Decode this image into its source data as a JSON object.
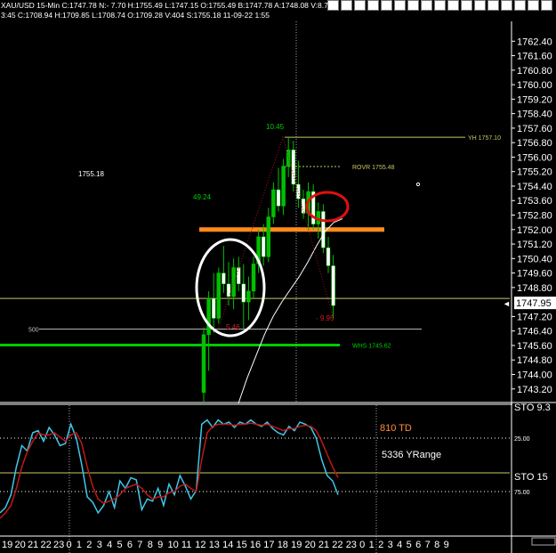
{
  "header": {
    "line1": "XAU/USD 15-Min C:1747.78 N:- 7.70 H:1755.49 L:1747.15 O:1755.49 B:1747.78 A:1748.08 V:8.77",
    "line2": "3:45 C:1708.94 H:1709.85 L:1708.74 O:1709.28 V:404 S:1755.18 11-09-22 1:55"
  },
  "toolbar": {
    "icons": [
      "help-icon",
      "candles-icon",
      "crosshair-icon",
      "draw-line-icon",
      "fib-icon",
      "line-icon",
      "zoom-icon",
      "stop-icon",
      "clock-icon",
      "refresh-icon",
      "layout-icon",
      "arrow-icon",
      "cross-icon",
      "text-icon",
      "move-icon",
      "split-icon",
      "window-icon"
    ]
  },
  "colors": {
    "background": "#000000",
    "candle_up": "#00c000",
    "candle_down": "#ffffff",
    "ma_line": "#ffffff",
    "level_line": "#c8c864",
    "orange_line": "#ff8c1a",
    "green_line": "#00cc00",
    "grey_line": "#c0c0c0",
    "red_circle": "#e01010",
    "stoch_fast": "#40c8e8",
    "stoch_slow": "#c01818",
    "annotation_orange": "#ff8c3a"
  },
  "chart_data": [
    {
      "type": "candlestick",
      "title": "XAU/USD 15-Min",
      "ylim": [
        1742.5,
        1763.2
      ],
      "y_ticks": [
        "1762.40",
        "1761.60",
        "1760.80",
        "1760.00",
        "1759.20",
        "1758.40",
        "1757.60",
        "1756.80",
        "1756.00",
        "1755.20",
        "1754.40",
        "1753.60",
        "1752.80",
        "1752.00",
        "1751.20",
        "1750.40",
        "1749.60",
        "1748.80",
        "1747.20",
        "1746.40",
        "1745.60",
        "1744.80",
        "1744.00",
        "1743.20"
      ],
      "last_price": "1747.95",
      "candles": [
        {
          "o": 1743.0,
          "h": 1746.6,
          "l": 1742.5,
          "c": 1746.2
        },
        {
          "o": 1746.2,
          "h": 1748.6,
          "l": 1744.2,
          "c": 1748.2
        },
        {
          "o": 1748.2,
          "h": 1749.6,
          "l": 1746.3,
          "c": 1747.1
        },
        {
          "o": 1747.1,
          "h": 1749.9,
          "l": 1746.8,
          "c": 1749.6
        },
        {
          "o": 1749.6,
          "h": 1751.1,
          "l": 1748.5,
          "c": 1749.0
        },
        {
          "o": 1749.0,
          "h": 1750.2,
          "l": 1747.8,
          "c": 1748.3
        },
        {
          "o": 1748.3,
          "h": 1750.4,
          "l": 1747.6,
          "c": 1749.9
        },
        {
          "o": 1749.9,
          "h": 1750.5,
          "l": 1748.6,
          "c": 1749.0
        },
        {
          "o": 1749.0,
          "h": 1750.1,
          "l": 1746.5,
          "c": 1748.0
        },
        {
          "o": 1748.0,
          "h": 1749.4,
          "l": 1747.0,
          "c": 1748.6
        },
        {
          "o": 1748.6,
          "h": 1750.5,
          "l": 1748.2,
          "c": 1750.1
        },
        {
          "o": 1750.1,
          "h": 1752.0,
          "l": 1749.6,
          "c": 1751.6
        },
        {
          "o": 1751.6,
          "h": 1752.3,
          "l": 1750.0,
          "c": 1750.5
        },
        {
          "o": 1750.5,
          "h": 1753.2,
          "l": 1750.2,
          "c": 1752.7
        },
        {
          "o": 1752.7,
          "h": 1754.6,
          "l": 1752.3,
          "c": 1754.2
        },
        {
          "o": 1754.2,
          "h": 1755.4,
          "l": 1753.0,
          "c": 1753.3
        },
        {
          "o": 1753.3,
          "h": 1755.9,
          "l": 1752.8,
          "c": 1755.5
        },
        {
          "o": 1755.5,
          "h": 1757.1,
          "l": 1754.9,
          "c": 1756.4
        },
        {
          "o": 1756.4,
          "h": 1756.9,
          "l": 1754.1,
          "c": 1754.5
        },
        {
          "o": 1754.5,
          "h": 1755.8,
          "l": 1753.2,
          "c": 1753.7
        },
        {
          "o": 1753.7,
          "h": 1754.2,
          "l": 1752.6,
          "c": 1752.9
        },
        {
          "o": 1752.9,
          "h": 1754.6,
          "l": 1752.0,
          "c": 1754.1
        },
        {
          "o": 1754.1,
          "h": 1754.5,
          "l": 1752.0,
          "c": 1752.3
        },
        {
          "o": 1752.3,
          "h": 1753.5,
          "l": 1751.5,
          "c": 1753.0
        },
        {
          "o": 1753.0,
          "h": 1753.4,
          "l": 1750.7,
          "c": 1751.0
        },
        {
          "o": 1751.0,
          "h": 1751.6,
          "l": 1749.6,
          "c": 1750.0
        },
        {
          "o": 1750.0,
          "h": 1750.6,
          "l": 1747.1,
          "c": 1747.8
        }
      ],
      "ma": [
        1742.4,
        1743.8,
        1745.0,
        1746.2,
        1747.2,
        1748.0,
        1748.7,
        1749.4,
        1750.2,
        1751.1,
        1751.9,
        1752.4,
        1752.6
      ],
      "levels": [
        {
          "name": "YH 1757.10",
          "value": 1757.1,
          "color": "#c8c864"
        },
        {
          "name": "ROVR 1755.48",
          "value": 1755.48,
          "color": "#c8c864",
          "dashed": true
        },
        {
          "name": "",
          "value": 1752.0,
          "color": "#ff8c1a",
          "thick": true
        },
        {
          "name": "",
          "value": 1748.2,
          "color": "#c8c864"
        },
        {
          "name": "500",
          "value": 1746.5,
          "color": "#c0c0c0"
        },
        {
          "name": "WHS 1745.62",
          "value": 1745.62,
          "color": "#00cc00",
          "thick": true
        }
      ],
      "annotations": [
        "1755.18",
        "49.24",
        "10.45",
        "- 9.95",
        "5.46"
      ]
    },
    {
      "type": "line",
      "title": "STO",
      "labels": [
        "STO 9.3",
        "STO 15"
      ],
      "y_ticks": [
        "25.00",
        "75.00"
      ],
      "ylim": [
        0,
        100
      ],
      "series": [
        {
          "name": "fast",
          "values": [
            5,
            10,
            22,
            48,
            68,
            63,
            80,
            82,
            72,
            85,
            78,
            68,
            70,
            88,
            75,
            50,
            20,
            15,
            5,
            12,
            25,
            10,
            35,
            28,
            38,
            36,
            8,
            18,
            16,
            28,
            12,
            32,
            22,
            40,
            30,
            18,
            26,
            88,
            92,
            85,
            92,
            88,
            90,
            85,
            90,
            88,
            92,
            88,
            86,
            90,
            84,
            80,
            78,
            86,
            82,
            90,
            88,
            85,
            75,
            55,
            40,
            35,
            22
          ]
        },
        {
          "name": "slow",
          "values": [
            0,
            5,
            12,
            28,
            48,
            62,
            72,
            80,
            78,
            78,
            80,
            76,
            72,
            78,
            80,
            70,
            48,
            30,
            18,
            14,
            16,
            18,
            22,
            28,
            30,
            32,
            28,
            22,
            18,
            20,
            20,
            24,
            25,
            30,
            32,
            28,
            25,
            55,
            80,
            86,
            88,
            88,
            88,
            87,
            88,
            88,
            89,
            88,
            87,
            88,
            86,
            84,
            82,
            84,
            84,
            86,
            87,
            86,
            82,
            72,
            60,
            48,
            38
          ]
        }
      ]
    }
  ],
  "annotations": {
    "td": "810 TD",
    "yrange": "5336 YRange"
  },
  "time_axis": {
    "labels": [
      "19",
      "20",
      "21",
      "22",
      "23",
      "0",
      "1",
      "2",
      "3",
      "4",
      "5",
      "6",
      "7",
      "8",
      "9",
      "10",
      "11",
      "12",
      "13",
      "14",
      "15",
      "16",
      "17",
      "18",
      "19",
      "20",
      "21",
      "22",
      "23",
      "0",
      "1",
      "2",
      "3",
      "4",
      "5",
      "6",
      "7",
      "8",
      "9"
    ]
  }
}
